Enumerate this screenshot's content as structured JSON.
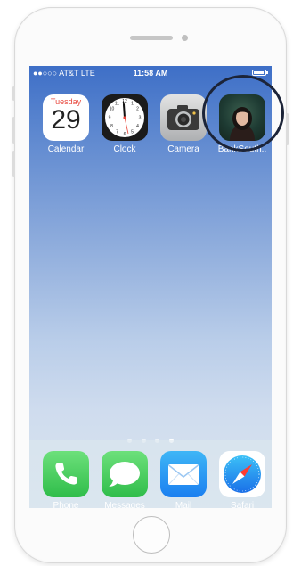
{
  "status_bar": {
    "carrier": "●●○○○ AT&T  LTE",
    "time": "11:58 AM"
  },
  "home_screen": {
    "apps": [
      {
        "label": "Calendar",
        "icon": "calendar-icon",
        "weekday": "Tuesday",
        "date": "29"
      },
      {
        "label": "Clock",
        "icon": "clock-icon"
      },
      {
        "label": "Camera",
        "icon": "camera-icon"
      },
      {
        "label": "BankSouth..",
        "icon": "bank-app-icon"
      }
    ],
    "page_indicator": {
      "pages": 4,
      "current": 4
    }
  },
  "dock": {
    "apps": [
      {
        "label": "Phone",
        "icon": "phone-icon"
      },
      {
        "label": "Messages",
        "icon": "messages-icon"
      },
      {
        "label": "Mail",
        "icon": "mail-icon"
      },
      {
        "label": "Safari",
        "icon": "safari-icon"
      }
    ]
  },
  "colors": {
    "highlight_ring": "#1c2438",
    "calendar_weekday": "#e8463b",
    "wallpaper_top": "#3e6fc7",
    "wallpaper_bottom": "#d9e5ef"
  }
}
